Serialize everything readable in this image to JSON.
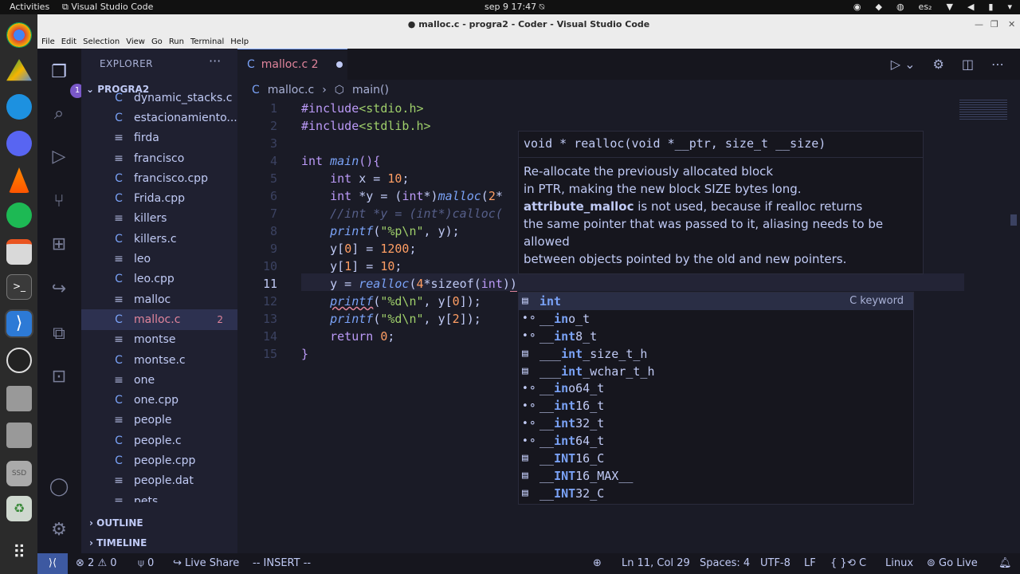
{
  "os": {
    "activities": "Activities",
    "app_name": "Visual Studio Code",
    "clock": "sep 9  17:47",
    "lang": "es₂"
  },
  "window": {
    "title": "● malloc.c - progra2 - Coder - Visual Studio Code"
  },
  "menu": [
    "File",
    "Edit",
    "Selection",
    "View",
    "Go",
    "Run",
    "Terminal",
    "Help"
  ],
  "explorer": {
    "title": "EXPLORER",
    "more": "···",
    "project": "PROGRA2",
    "files": [
      {
        "name": "dynamic_stacks.c",
        "icon": "C"
      },
      {
        "name": "estacionamiento...",
        "icon": "C"
      },
      {
        "name": "firda",
        "icon": "≡"
      },
      {
        "name": "francisco",
        "icon": "≡"
      },
      {
        "name": "francisco.cpp",
        "icon": "C"
      },
      {
        "name": "Frida.cpp",
        "icon": "C"
      },
      {
        "name": "killers",
        "icon": "≡"
      },
      {
        "name": "killers.c",
        "icon": "C"
      },
      {
        "name": "leo",
        "icon": "≡"
      },
      {
        "name": "leo.cpp",
        "icon": "C"
      },
      {
        "name": "malloc",
        "icon": "≡"
      },
      {
        "name": "malloc.c",
        "icon": "C",
        "badge": "2",
        "selected": true
      },
      {
        "name": "montse",
        "icon": "≡"
      },
      {
        "name": "montse.c",
        "icon": "C"
      },
      {
        "name": "one",
        "icon": "≡"
      },
      {
        "name": "one.cpp",
        "icon": "C"
      },
      {
        "name": "people",
        "icon": "≡"
      },
      {
        "name": "people.c",
        "icon": "C"
      },
      {
        "name": "people.cpp",
        "icon": "C"
      },
      {
        "name": "people.dat",
        "icon": "≡"
      },
      {
        "name": "pets",
        "icon": "≡"
      }
    ],
    "outline": "OUTLINE",
    "timeline": "TIMELINE"
  },
  "activity": {
    "explorer_badge": "1"
  },
  "tab": {
    "label": "malloc.c 2"
  },
  "breadcrumb": {
    "file": "malloc.c",
    "symbol": "main()"
  },
  "editor": {
    "line_numbers": [
      "1",
      "2",
      "3",
      "4",
      "5",
      "6",
      "7",
      "8",
      "9",
      "10",
      "11",
      "12",
      "13",
      "14",
      "15"
    ],
    "current_line": 11
  },
  "hover": {
    "signature": "void * realloc(void *__ptr, size_t __size)",
    "doc1": "Re-allocate the previously allocated block",
    "doc2": "in PTR, making the new block SIZE bytes long.",
    "doc3_bold": "attribute_malloc",
    "doc3_rest": " is not used, because if realloc returns",
    "doc4": "the same pointer that was passed to it, aliasing needs to be",
    "doc5": "allowed",
    "doc6": "between objects pointed by the old and new pointers."
  },
  "suggest": [
    {
      "pre": "",
      "hl": "int",
      "post": "",
      "detail": "C keyword",
      "kind": "keyword"
    },
    {
      "pre": "__",
      "hl": "in",
      "post": "o_t",
      "kind": "struct"
    },
    {
      "pre": "__",
      "hl": "int",
      "post": "8_t",
      "kind": "struct"
    },
    {
      "pre": "___",
      "hl": "int",
      "post": "_size_t_h",
      "kind": "macro"
    },
    {
      "pre": "___",
      "hl": "int",
      "post": "_wchar_t_h",
      "kind": "macro"
    },
    {
      "pre": "__",
      "hl": "in",
      "post": "o64_t",
      "kind": "struct"
    },
    {
      "pre": "__",
      "hl": "int",
      "post": "16_t",
      "kind": "struct"
    },
    {
      "pre": "__",
      "hl": "int",
      "post": "32_t",
      "kind": "struct"
    },
    {
      "pre": "__",
      "hl": "int",
      "post": "64_t",
      "kind": "struct"
    },
    {
      "pre": "__",
      "hl": "INT",
      "post": "16_C",
      "kind": "macro"
    },
    {
      "pre": "__",
      "hl": "INT",
      "post": "16_MAX__",
      "kind": "macro"
    },
    {
      "pre": "__",
      "hl": "INT",
      "post": "32_C",
      "kind": "macro"
    }
  ],
  "status": {
    "errors": "2",
    "warnings": "0",
    "ports": "0",
    "liveshare": "Live Share",
    "mode": "-- INSERT --",
    "position": "Ln 11, Col 29",
    "spaces": "Spaces: 4",
    "encoding": "UTF-8",
    "eol": "LF",
    "braces": "{ }",
    "lang": "C",
    "os": "Linux",
    "golive": "Go Live"
  },
  "colors": {
    "accent": "#7aa2f7",
    "keyword": "#bb9af7",
    "string": "#9ece6a",
    "number": "#ff9e64",
    "error": "#e0849b"
  }
}
